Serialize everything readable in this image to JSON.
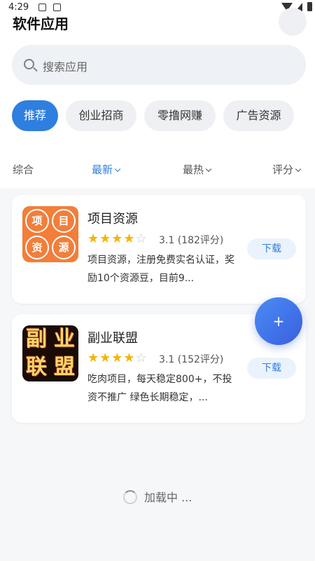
{
  "status_bar": {
    "time": "4:29"
  },
  "header": {
    "title": "软件应用"
  },
  "search": {
    "placeholder": "搜索应用"
  },
  "categories": [
    {
      "label": "推荐",
      "active": true
    },
    {
      "label": "创业招商",
      "active": false
    },
    {
      "label": "零撸网赚",
      "active": false
    },
    {
      "label": "广告资源",
      "active": false
    }
  ],
  "sort_options": [
    {
      "label": "综合"
    },
    {
      "label": "最新"
    },
    {
      "label": "最热"
    },
    {
      "label": "评分"
    }
  ],
  "apps": [
    {
      "name": "项目资源",
      "logo_text": [
        "项",
        "目",
        "资",
        "源"
      ],
      "stars": 4,
      "max_stars": 5,
      "rating": "3.1 (182评分)",
      "description": "项目资源，注册免费实名认证，奖励10个资源豆，目前9...",
      "download_label": "下载"
    },
    {
      "name": "副业联盟",
      "logo_text": [
        "副",
        "业",
        "联",
        "盟"
      ],
      "stars": 4,
      "max_stars": 5,
      "rating": "3.1 (152评分)",
      "description": "吃肉项目，每天稳定800+，不投资不推广 绿色长期稳定，...",
      "download_label": "下载"
    }
  ],
  "fab": {
    "label": "+"
  },
  "loading": {
    "text": "加载中 ..."
  },
  "colors": {
    "accent": "#2f7fe0",
    "star": "#f5b400",
    "logo1_bg": "#f27e3a",
    "logo2_bg": "#1a0b07"
  }
}
